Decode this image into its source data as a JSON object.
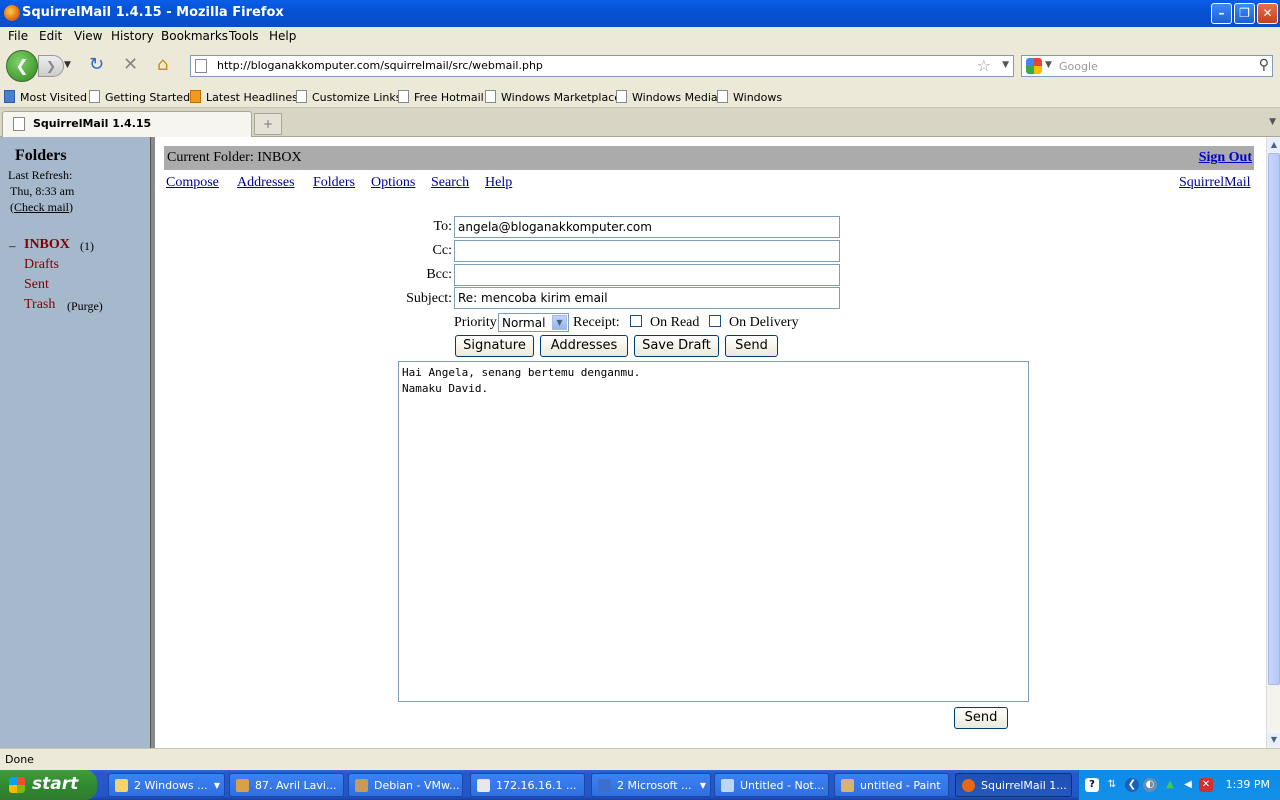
{
  "window": {
    "title": "SquirrelMail 1.4.15 - Mozilla Firefox"
  },
  "menu": [
    "File",
    "Edit",
    "View",
    "History",
    "Bookmarks",
    "Tools",
    "Help"
  ],
  "nav": {
    "url": "http://bloganakkomputer.com/squirrelmail/src/webmail.php",
    "search_placeholder": "Google"
  },
  "bookmarks": [
    "Most Visited",
    "Getting Started",
    "Latest Headlines",
    "Customize Links",
    "Free Hotmail",
    "Windows Marketplace",
    "Windows Media",
    "Windows"
  ],
  "tab": {
    "title": "SquirrelMail 1.4.15"
  },
  "sidebar": {
    "heading": "Folders",
    "last_refresh": "Last Refresh:",
    "refresh_time": "Thu, 8:33 am",
    "check_mail": "Check mail",
    "inbox_prefix": "–",
    "folders": [
      {
        "name": "INBOX",
        "extra": "(1)"
      },
      {
        "name": "Drafts",
        "extra": ""
      },
      {
        "name": "Sent",
        "extra": ""
      },
      {
        "name": "Trash",
        "extra": "(Purge)"
      }
    ]
  },
  "header": {
    "current_folder_label": "Current Folder:",
    "current_folder": "INBOX",
    "sign_out": "Sign Out",
    "links": [
      "Compose",
      "Addresses",
      "Folders",
      "Options",
      "Search",
      "Help"
    ],
    "brand": "SquirrelMail"
  },
  "compose": {
    "to_label": "To:",
    "to": "angela@bloganakkomputer.com",
    "cc_label": "Cc:",
    "cc": "",
    "bcc_label": "Bcc:",
    "bcc": "",
    "subject_label": "Subject:",
    "subject": "Re: mencoba kirim email",
    "priority_label": "Priority",
    "priority": "Normal",
    "receipt_label": "Receipt:",
    "on_read": "On Read",
    "on_delivery": "On Delivery",
    "buttons": {
      "signature": "Signature",
      "addresses": "Addresses",
      "save_draft": "Save Draft",
      "send": "Send"
    },
    "body_lines": [
      "Hai Angela, senang bertemu denganmu.",
      "Namaku David."
    ],
    "send_bottom": "Send"
  },
  "status": "Done",
  "taskbar": {
    "start": "start",
    "tasks": [
      "2 Windows ...",
      "87. Avril Lavi...",
      "Debian - VMw...",
      "172.16.16.1 ...",
      "2 Microsoft ...",
      "Untitled - Not...",
      "untitled - Paint",
      "SquirrelMail 1..."
    ],
    "clock": "1:39 PM"
  },
  "colors": {
    "folder_link": "#800000",
    "sidebar_bg": "#a6b9cc",
    "header_bar": "#ababab",
    "link": "#00009c"
  }
}
